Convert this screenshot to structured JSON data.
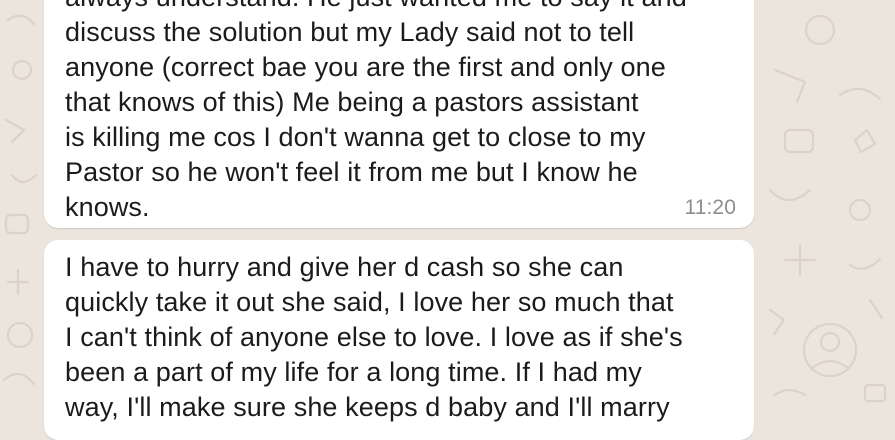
{
  "chat": {
    "background_color": "#ece5dd",
    "bubble_color": "#ffffff",
    "messages": [
      {
        "text": "always understand. He just wanted me to say it and\ndiscuss the solution but my Lady said not to tell\nanyone (correct bae you are the first and only one\nthat knows of this) Me being a pastors assistant\nis killing me cos I don't wanna get to close to my\nPastor so he won't feel it from me but I know he\nknows.",
        "time": "11:20"
      },
      {
        "text": "I have to hurry and give her d cash so she can\nquickly take it out she said, I love her so much that\nI can't think of anyone else to love. I love as if she's\nbeen a part of my life for a long time. If I had my\nway, I'll make sure she keeps d baby and I'll marry"
      }
    ]
  }
}
